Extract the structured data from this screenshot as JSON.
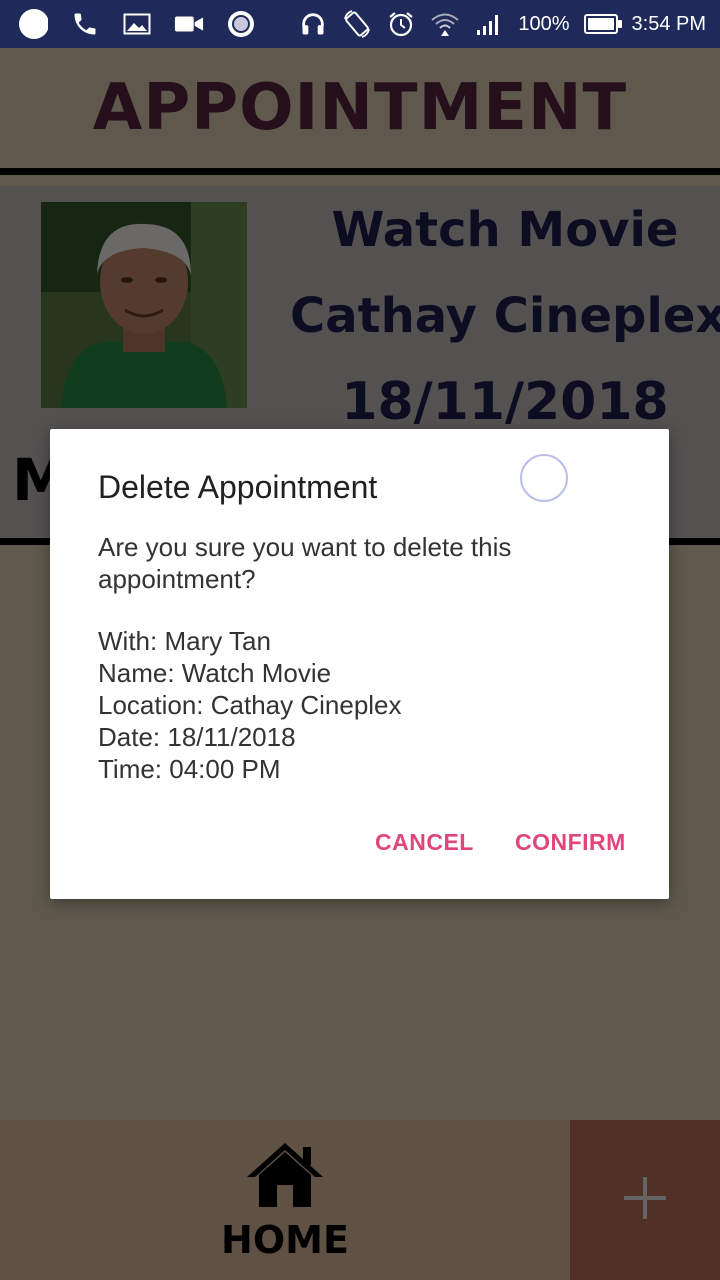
{
  "status_bar": {
    "battery": "100%",
    "time": "3:54 PM",
    "left_icons": [
      "record-icon",
      "phone-icon",
      "image-icon",
      "video-icon",
      "target-icon"
    ],
    "right_icons": [
      "headphones-icon",
      "rotate-icon",
      "alarm-icon",
      "wifi-icon",
      "signal-icon"
    ]
  },
  "header": {
    "title": "APPOINTMENT"
  },
  "card": {
    "name": "Watch Movie",
    "location": "Cathay Cineplex",
    "date": "18/11/2018",
    "with_initial": "M"
  },
  "dialog": {
    "title": "Delete Appointment",
    "message": "Are you sure you want to delete this appointment?",
    "details": {
      "with": "With: Mary Tan",
      "name": "Name: Watch Movie",
      "location": "Location: Cathay Cineplex",
      "date": "Date: 18/11/2018",
      "time": "Time: 04:00 PM"
    },
    "cancel_label": "CANCEL",
    "confirm_label": "CONFIRM"
  },
  "bottom_nav": {
    "home_label": "HOME",
    "add_icon": "plus-icon"
  },
  "colors": {
    "status_bar": "#1f2a5a",
    "header_bg": "#bfb39b",
    "title_text": "#4a1e36",
    "card_bg": "#a9a2a2",
    "accent": "#e0457b",
    "nav_home": "#bfa387",
    "nav_add": "#a3634a"
  }
}
